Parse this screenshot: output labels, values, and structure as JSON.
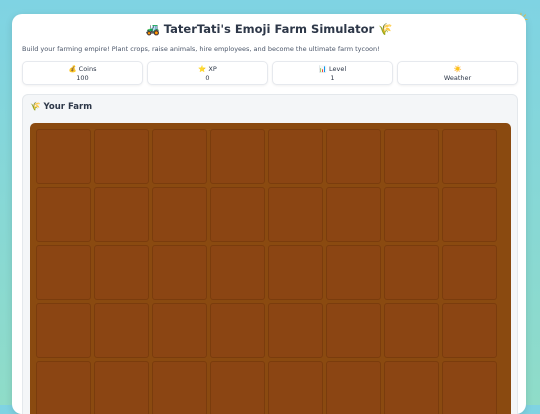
{
  "weather_icon": "sun-icon",
  "header": {
    "title": "🚜 TaterTati's Emoji Farm Simulator 🌾",
    "subtitle": "Build your farming empire! Plant crops, raise animals, hire employees, and become the ultimate farm tycoon!"
  },
  "stats": [
    {
      "label": "💰 Coins",
      "value": "100"
    },
    {
      "label": "⭐ XP",
      "value": "0"
    },
    {
      "label": "📊 Level",
      "value": "1"
    },
    {
      "label": "☀️",
      "value": "Weather"
    }
  ],
  "farm": {
    "heading": "🌾 Your Farm",
    "columns": 8,
    "visible_rows": 5,
    "plots": 40
  },
  "colors": {
    "background": "#7fd3e3",
    "soil": "#8b4513",
    "panel": "#ffffff"
  }
}
